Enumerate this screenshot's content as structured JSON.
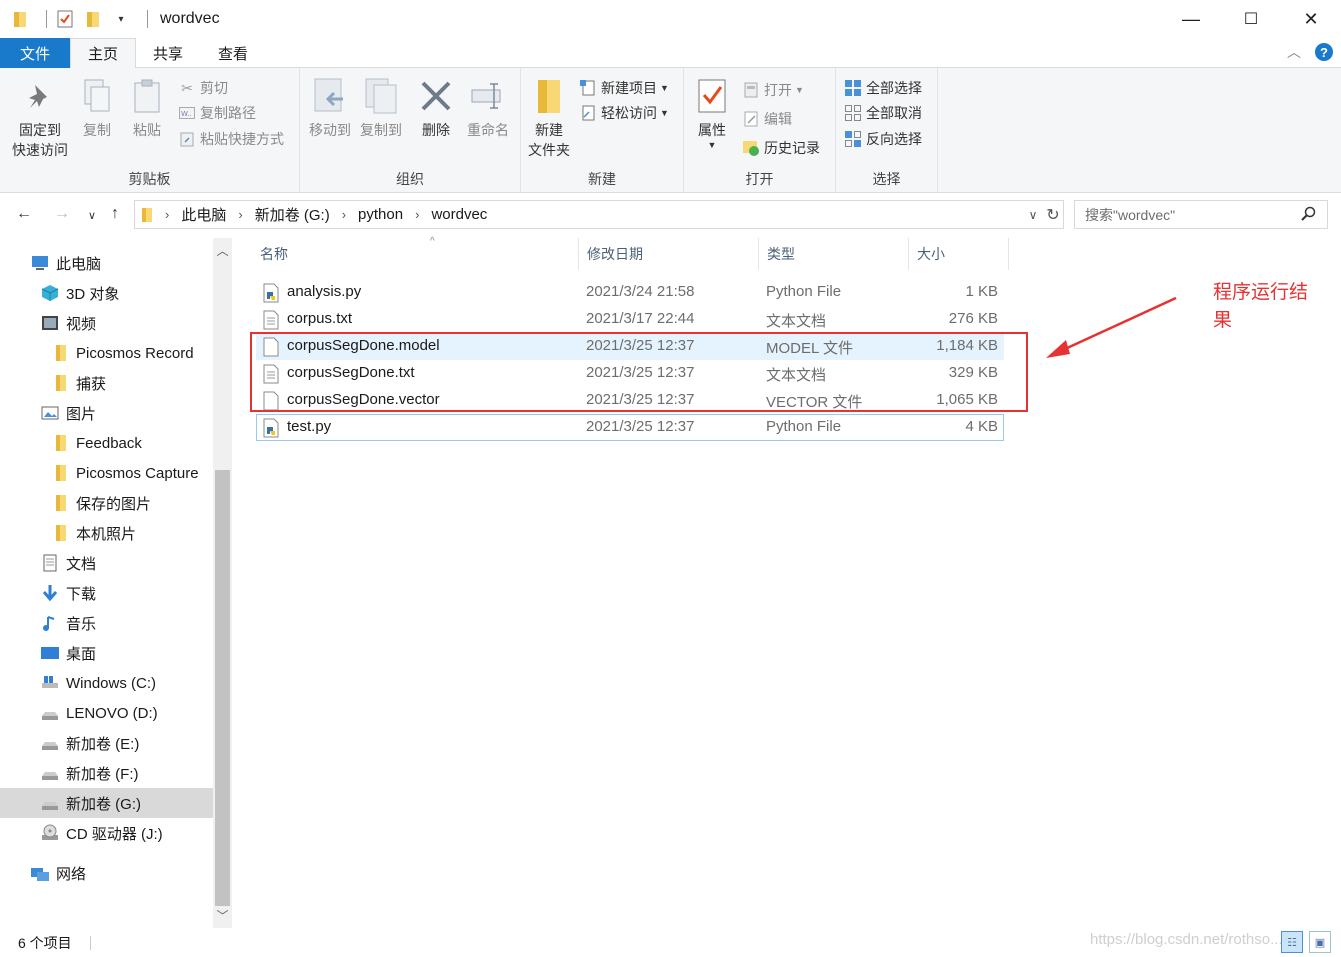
{
  "window": {
    "title": "wordvec",
    "minimize": "—",
    "maximize": "☐",
    "close": "✕"
  },
  "ribbon_tabs": {
    "file": "文件",
    "home": "主页",
    "share": "共享",
    "view": "查看"
  },
  "ribbon": {
    "clipboard": {
      "label": "剪贴板",
      "pin_line1": "固定到",
      "pin_line2": "快速访问",
      "copy": "复制",
      "paste": "粘贴",
      "cut": "剪切",
      "copy_path": "复制路径",
      "paste_shortcut": "粘贴快捷方式"
    },
    "organize": {
      "label": "组织",
      "move_to": "移动到",
      "copy_to": "复制到",
      "delete": "删除",
      "rename": "重命名"
    },
    "new": {
      "label": "新建",
      "new_folder_line1": "新建",
      "new_folder_line2": "文件夹",
      "new_item": "新建项目",
      "easy_access": "轻松访问"
    },
    "open": {
      "label": "打开",
      "properties": "属性",
      "open": "打开",
      "edit": "编辑",
      "history": "历史记录"
    },
    "select": {
      "label": "选择",
      "select_all": "全部选择",
      "select_none": "全部取消",
      "invert": "反向选择"
    }
  },
  "address": {
    "crumbs": [
      "此电脑",
      "新加卷 (G:)",
      "python",
      "wordvec"
    ],
    "search_placeholder": "搜索\"wordvec\""
  },
  "nav_pane": [
    {
      "label": "此电脑",
      "icon": "pc-icon",
      "indent": 1
    },
    {
      "label": "3D 对象",
      "icon": "3d-objects-icon",
      "indent": 2
    },
    {
      "label": "视频",
      "icon": "video-icon",
      "indent": 2
    },
    {
      "label": "Picosmos Record",
      "icon": "folder-icon",
      "indent": 3
    },
    {
      "label": "捕获",
      "icon": "folder-icon",
      "indent": 3
    },
    {
      "label": "图片",
      "icon": "pictures-icon",
      "indent": 2
    },
    {
      "label": "Feedback",
      "icon": "folder-icon",
      "indent": 3
    },
    {
      "label": "Picosmos Capture",
      "icon": "folder-icon",
      "indent": 3
    },
    {
      "label": "保存的图片",
      "icon": "folder-icon",
      "indent": 3
    },
    {
      "label": "本机照片",
      "icon": "folder-icon",
      "indent": 3
    },
    {
      "label": "文档",
      "icon": "documents-icon",
      "indent": 2
    },
    {
      "label": "下载",
      "icon": "download-icon",
      "indent": 2
    },
    {
      "label": "音乐",
      "icon": "music-icon",
      "indent": 2
    },
    {
      "label": "桌面",
      "icon": "desktop-icon",
      "indent": 2
    },
    {
      "label": "Windows (C:)",
      "icon": "windows-drive-icon",
      "indent": 2
    },
    {
      "label": "LENOVO (D:)",
      "icon": "drive-icon",
      "indent": 2
    },
    {
      "label": "新加卷 (E:)",
      "icon": "drive-icon",
      "indent": 2
    },
    {
      "label": "新加卷 (F:)",
      "icon": "drive-icon",
      "indent": 2
    },
    {
      "label": "新加卷 (G:)",
      "icon": "drive-icon",
      "indent": 2,
      "selected": true
    },
    {
      "label": "CD 驱动器 (J:)",
      "icon": "cd-drive-icon",
      "indent": 2
    },
    {
      "label": "网络",
      "icon": "network-icon",
      "indent": 1
    }
  ],
  "columns": {
    "name": "名称",
    "date": "修改日期",
    "type": "类型",
    "size": "大小"
  },
  "files": [
    {
      "name": "analysis.py",
      "date": "2021/3/24 21:58",
      "type": "Python File",
      "size": "1 KB",
      "icon": "python-file-icon"
    },
    {
      "name": "corpus.txt",
      "date": "2021/3/17 22:44",
      "type": "文本文档",
      "size": "276 KB",
      "icon": "text-file-icon"
    },
    {
      "name": "corpusSegDone.model",
      "date": "2021/3/25 12:37",
      "type": "MODEL 文件",
      "size": "1,184 KB",
      "icon": "generic-file-icon",
      "highlighted": true
    },
    {
      "name": "corpusSegDone.txt",
      "date": "2021/3/25 12:37",
      "type": "文本文档",
      "size": "329 KB",
      "icon": "text-file-icon"
    },
    {
      "name": "corpusSegDone.vector",
      "date": "2021/3/25 12:37",
      "type": "VECTOR 文件",
      "size": "1,065 KB",
      "icon": "generic-file-icon"
    },
    {
      "name": "test.py",
      "date": "2021/3/25 12:37",
      "type": "Python File",
      "size": "4 KB",
      "icon": "python-file-icon",
      "focused": true
    }
  ],
  "annotation": {
    "text": "程序运行结果",
    "color": "#e63232"
  },
  "status": {
    "count": "6 个项目",
    "watermark": "https://blog.csdn.net/rothso..."
  },
  "colors": {
    "accent": "#1979ca",
    "annotation": "#e63232",
    "folder": "#f8d775"
  }
}
